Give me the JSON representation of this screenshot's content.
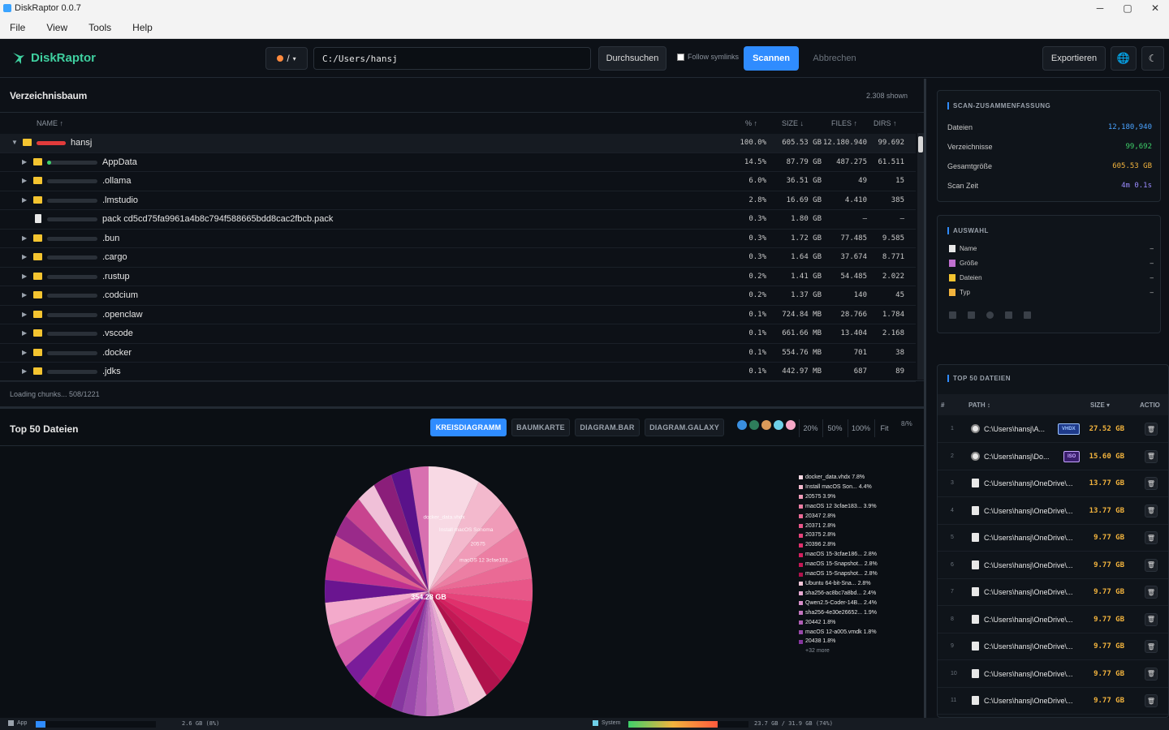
{
  "window": {
    "title": "DiskRaptor 0.0.7",
    "min": "─",
    "max": "▢",
    "close": "✕"
  },
  "menu": [
    "File",
    "View",
    "Tools",
    "Help"
  ],
  "toolbar": {
    "brand": "DiskRaptor",
    "drive": "/",
    "path_value": "C:/Users/hansj",
    "browse": "Durchsuchen",
    "follow_symlinks": "Follow symlinks",
    "scan": "Scannen",
    "abort": "Abbrechen",
    "export": "Exportieren",
    "globe": "🌐",
    "moon": "☾"
  },
  "tree": {
    "title": "Verzeichnisbaum",
    "shown": "2.308 shown",
    "columns": {
      "name": "NAME ↑",
      "pct": "% ↑",
      "size": "SIZE ↓",
      "files": "FILES ↑",
      "dirs": "DIRS ↑"
    },
    "rows": [
      {
        "name": "hansj",
        "pct": "100.0%",
        "size": "605.53 GB",
        "files": "12.180.940",
        "dirs": "99.692",
        "type": "folder",
        "depth": 0,
        "expanded": true,
        "fill": 1.0
      },
      {
        "name": "AppData",
        "pct": "14.5%",
        "size": "87.79 GB",
        "files": "487.275",
        "dirs": "61.511",
        "type": "folder",
        "depth": 1,
        "fill": 0.145
      },
      {
        "name": ".ollama",
        "pct": "6.0%",
        "size": "36.51 GB",
        "files": "49",
        "dirs": "15",
        "type": "folder",
        "depth": 1,
        "fill": 0.06
      },
      {
        "name": ".lmstudio",
        "pct": "2.8%",
        "size": "16.69 GB",
        "files": "4.410",
        "dirs": "385",
        "type": "folder",
        "depth": 1,
        "fill": 0.028
      },
      {
        "name": "pack cd5cd75fa9961a4b8c794f588665bdd8cac2fbcb.pack",
        "pct": "0.3%",
        "size": "1.80 GB",
        "files": "–",
        "dirs": "–",
        "type": "file",
        "depth": 1,
        "fill": 0.003
      },
      {
        "name": ".bun",
        "pct": "0.3%",
        "size": "1.72 GB",
        "files": "77.485",
        "dirs": "9.585",
        "type": "folder",
        "depth": 1,
        "fill": 0.003
      },
      {
        "name": ".cargo",
        "pct": "0.3%",
        "size": "1.64 GB",
        "files": "37.674",
        "dirs": "8.771",
        "type": "folder",
        "depth": 1,
        "fill": 0.003
      },
      {
        "name": ".rustup",
        "pct": "0.2%",
        "size": "1.41 GB",
        "files": "54.485",
        "dirs": "2.022",
        "type": "folder",
        "depth": 1,
        "fill": 0.002
      },
      {
        "name": ".codcium",
        "pct": "0.2%",
        "size": "1.37 GB",
        "files": "140",
        "dirs": "45",
        "type": "folder",
        "depth": 1,
        "fill": 0.002
      },
      {
        "name": ".openclaw",
        "pct": "0.1%",
        "size": "724.84 MB",
        "files": "28.766",
        "dirs": "1.784",
        "type": "folder",
        "depth": 1,
        "fill": 0.001
      },
      {
        "name": ".vscode",
        "pct": "0.1%",
        "size": "661.66 MB",
        "files": "13.404",
        "dirs": "2.168",
        "type": "folder",
        "depth": 1,
        "fill": 0.001
      },
      {
        "name": ".docker",
        "pct": "0.1%",
        "size": "554.76 MB",
        "files": "701",
        "dirs": "38",
        "type": "folder",
        "depth": 1,
        "fill": 0.001
      },
      {
        "name": ".jdks",
        "pct": "0.1%",
        "size": "442.97 MB",
        "files": "687",
        "dirs": "89",
        "type": "folder",
        "depth": 1,
        "fill": 0.001
      }
    ],
    "loading": "Loading chunks... 508/1221"
  },
  "chart_panel": {
    "title": "Top 50 Dateien",
    "tabs": [
      "KREISDIAGRAMM",
      "BAUMKARTE",
      "DIAGRAM.BAR",
      "DIAGRAM.GALAXY"
    ],
    "active_tab": 0,
    "swatches": [
      "#3a8fe0",
      "#2e7d5b",
      "#d99a5a",
      "#6fd0e8",
      "#f7a8c8"
    ],
    "zoom": [
      "20%",
      "50%",
      "100%",
      "Fit"
    ],
    "corner": "8/%"
  },
  "chart_data": {
    "type": "pie",
    "center_label": "354.28 GB",
    "slices": [
      {
        "label": "docker_data.vhdx",
        "legend": "docker_data.vhdx 7.8%",
        "value": 7.8,
        "color": "#f8d9e4"
      },
      {
        "label": "Install macOS Sonoma",
        "legend": "Install macOS Son... 4.4%",
        "value": 4.4,
        "color": "#f3b9cd"
      },
      {
        "label": "20575",
        "legend": "20575 3.9%",
        "value": 3.9,
        "color": "#f09bb8"
      },
      {
        "label": "macOS 12 3cfae183...",
        "legend": "macOS 12 3cfae183... 3.9%",
        "value": 3.9,
        "color": "#ec7ea3"
      },
      {
        "label": "20347",
        "legend": "20347 2.8%",
        "value": 2.8,
        "color": "#ea6a95"
      },
      {
        "label": "20371",
        "legend": "20371 2.8%",
        "value": 2.8,
        "color": "#e85688"
      },
      {
        "label": "20375",
        "legend": "20375 2.8%",
        "value": 2.8,
        "color": "#e6437a"
      },
      {
        "label": "20396",
        "legend": "20396 2.8%",
        "value": 2.8,
        "color": "#e0306c"
      },
      {
        "label": "macOS 15-3cfae186...",
        "legend": "macOS 15-3cfae186... 2.8%",
        "value": 2.8,
        "color": "#d4205f"
      },
      {
        "label": "macOS 15-Snapshot...",
        "legend": "macOS 15-Snapshot... 2.8%",
        "value": 2.8,
        "color": "#c41855"
      },
      {
        "label": "macOS 15-Snapshot...",
        "legend": "macOS 15-Snapshot... 2.8%",
        "value": 2.8,
        "color": "#b0124c"
      },
      {
        "label": "Ubuntu 64-bit-Sna...",
        "legend": "Ubuntu 64-bit-Sna... 2.8%",
        "value": 2.8,
        "color": "#f4c6d8"
      },
      {
        "label": "sha256-ac8bc7a8bd...",
        "legend": "sha256-ac8bc7a8bd... 2.4%",
        "value": 2.4,
        "color": "#e8a9d2"
      },
      {
        "label": "Qwen2.5-Coder-14B...",
        "legend": "Qwen2.5-Coder-14B... 2.4%",
        "value": 2.4,
        "color": "#d98fca"
      },
      {
        "label": "sha256-4e30e26652...",
        "legend": "sha256-4e30e26652... 1.9%",
        "value": 1.9,
        "color": "#c576c0"
      },
      {
        "label": "20442",
        "legend": "20442 1.8%",
        "value": 1.8,
        "color": "#b05fb6"
      },
      {
        "label": "macOS 12-a005.vmdk",
        "legend": "macOS 12-a005.vmdk 1.8%",
        "value": 1.8,
        "color": "#9a49ab"
      },
      {
        "label": "20438",
        "legend": "20438 1.8%",
        "value": 1.8,
        "color": "#86369f"
      }
    ],
    "rest_value": 43.0,
    "legend_more": "+32 more"
  },
  "summary": {
    "title": "SCAN-ZUSAMMENFASSUNG",
    "items": [
      {
        "label": "Dateien",
        "value": "12,180,940",
        "color": "#4aa3ff"
      },
      {
        "label": "Verzeichnisse",
        "value": "99,692",
        "color": "#3fd06a"
      },
      {
        "label": "Gesamtgröße",
        "value": "605.53 GB",
        "color": "#f2b33d"
      },
      {
        "label": "Scan Zeit",
        "value": "4m 0.1s",
        "color": "#9b8cff"
      }
    ]
  },
  "selection": {
    "title": "AUSWAHL",
    "items": [
      {
        "label": "Name",
        "value": "–",
        "icon_color": "#e8e8e8"
      },
      {
        "label": "Größe",
        "value": "–",
        "icon_color": "#c070d0"
      },
      {
        "label": "Dateien",
        "value": "–",
        "icon_color": "#f4c430"
      },
      {
        "label": "Typ",
        "value": "–",
        "icon_color": "#f2b33d"
      }
    ]
  },
  "top_files": {
    "title": "TOP 50 DATEIEN",
    "columns": {
      "num": "#",
      "path": "PATH ↕",
      "size": "SIZE ▾",
      "actions": "ACTIO"
    },
    "rows": [
      {
        "n": "1",
        "path": "C:\\Users\\hansj\\A...",
        "badge": "VHDX",
        "badge_bg": "#1e3a8a",
        "badge_fg": "#9cc3ff",
        "size": "27.52 GB",
        "icon": "disc"
      },
      {
        "n": "2",
        "path": "C:\\Users\\hansj\\Do...",
        "badge": "ISO",
        "badge_bg": "#3b1e6e",
        "badge_fg": "#c7a6ff",
        "size": "15.60 GB",
        "icon": "disc"
      },
      {
        "n": "3",
        "path": "C:\\Users\\hansj\\OneDrive\\...",
        "badge": "",
        "size": "13.77 GB",
        "icon": "file"
      },
      {
        "n": "4",
        "path": "C:\\Users\\hansj\\OneDrive\\...",
        "badge": "",
        "size": "13.77 GB",
        "icon": "file"
      },
      {
        "n": "5",
        "path": "C:\\Users\\hansj\\OneDrive\\...",
        "badge": "",
        "size": "9.77 GB",
        "icon": "file"
      },
      {
        "n": "6",
        "path": "C:\\Users\\hansj\\OneDrive\\...",
        "badge": "",
        "size": "9.77 GB",
        "icon": "file"
      },
      {
        "n": "7",
        "path": "C:\\Users\\hansj\\OneDrive\\...",
        "badge": "",
        "size": "9.77 GB",
        "icon": "file"
      },
      {
        "n": "8",
        "path": "C:\\Users\\hansj\\OneDrive\\...",
        "badge": "",
        "size": "9.77 GB",
        "icon": "file"
      },
      {
        "n": "9",
        "path": "C:\\Users\\hansj\\OneDrive\\...",
        "badge": "",
        "size": "9.77 GB",
        "icon": "file"
      },
      {
        "n": "10",
        "path": "C:\\Users\\hansj\\OneDrive\\...",
        "badge": "",
        "size": "9.77 GB",
        "icon": "file"
      },
      {
        "n": "11",
        "path": "C:\\Users\\hansj\\OneDrive\\...",
        "badge": "",
        "size": "9.77 GB",
        "icon": "file"
      }
    ],
    "delete_icon": "🗑"
  },
  "status": {
    "app_label": "App",
    "app_mem": "2.6 GB (8%)",
    "app_fill": 0.08,
    "system_label": "System",
    "system_mem": "23.7 GB / 31.9 GB (74%)",
    "system_fill": 0.74
  }
}
